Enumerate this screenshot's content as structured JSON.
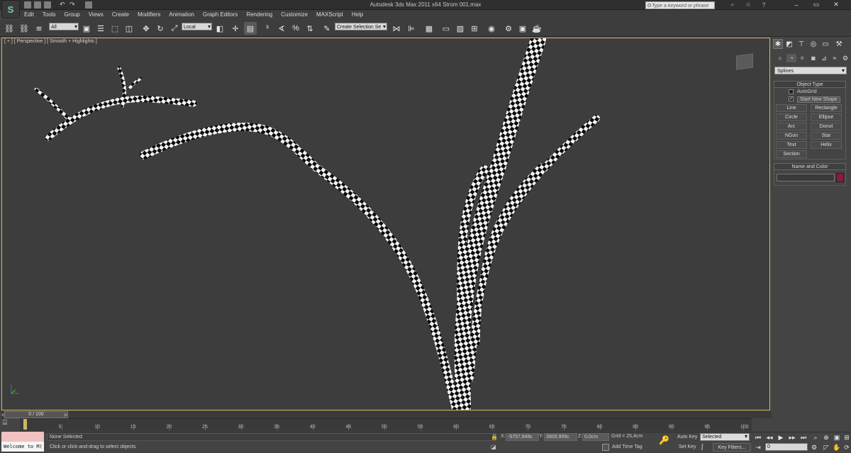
{
  "app": {
    "logo": "S",
    "title": "Autodesk 3ds Max  2011 x64      Strom 001.max",
    "search_placeholder": "Type a keyword or phrase",
    "window_controls": [
      "–",
      "▭",
      "✕"
    ]
  },
  "menu": [
    "Edit",
    "Tools",
    "Group",
    "Views",
    "Create",
    "Modifiers",
    "Animation",
    "Graph Editors",
    "Rendering",
    "Customize",
    "MAXScript",
    "Help"
  ],
  "toolbar": {
    "selection_filter": "All",
    "reference_coord": "Local",
    "selection_set": "Create Selection Se"
  },
  "viewport": {
    "label": "[ + ] [ Perspective ] [ Smooth + Highlights ]"
  },
  "command_panel": {
    "category": "Splines",
    "object_type_header": "Object Type",
    "autogrid_label": "AutoGrid",
    "start_new_shape_label": "Start New Shape",
    "start_new_shape_checked": true,
    "buttons": [
      "Line",
      "Rectangle",
      "Circle",
      "Ellipse",
      "Arc",
      "Donut",
      "NGon",
      "Star",
      "Text",
      "Helix",
      "Section"
    ],
    "name_color_header": "Name and Color",
    "object_color": "#8c1a3a"
  },
  "timeline": {
    "slider_label": "0 / 100",
    "ticks": [
      "5",
      "10",
      "15",
      "20",
      "25",
      "30",
      "35",
      "40",
      "45",
      "50",
      "55",
      "60",
      "65",
      "70",
      "75",
      "80",
      "85",
      "90",
      "95",
      "100"
    ]
  },
  "status": {
    "listener_text": "Welcome to M(",
    "selection": "None Selected",
    "prompt": "Click or click-and-drag to select objects",
    "x_label": "X:",
    "x_value": "-5757,849c",
    "y_label": "Y:",
    "y_value": "3909,959c",
    "z_label": "Z:",
    "z_value": "0,0cm",
    "grid": "Grid = 25,4cm",
    "add_time_tag": "Add Time Tag",
    "auto_key": "Auto Key",
    "set_key": "Set Key",
    "key_mode_selected": "Selected",
    "key_filters": "Key Filters...",
    "current_frame": "0"
  }
}
